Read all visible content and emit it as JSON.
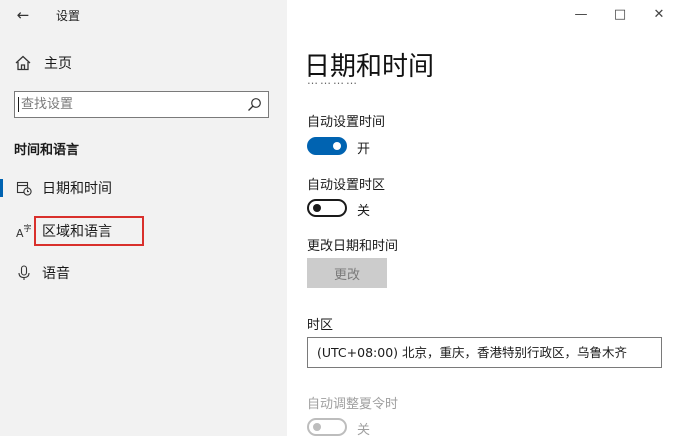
{
  "window": {
    "title": "设置",
    "controls": [
      "minimize-icon",
      "maximize-icon",
      "close-icon"
    ]
  },
  "sidebar": {
    "home_label": "主页",
    "search": {
      "placeholder": "查找设置",
      "value": ""
    },
    "section_title": "时间和语言",
    "items": [
      {
        "label": "日期和时间",
        "icon": "calendar-clock-icon",
        "active": true
      },
      {
        "label": "区域和语言",
        "icon": "language-icon",
        "highlighted": true
      },
      {
        "label": "语音",
        "icon": "microphone-icon"
      }
    ]
  },
  "main": {
    "title": "日期和时间",
    "clipped_text": "…………",
    "auto_time": {
      "label": "自动设置时间",
      "state": "开"
    },
    "auto_timezone": {
      "label": "自动设置时区",
      "state": "关"
    },
    "change_datetime": {
      "label": "更改日期和时间",
      "button": "更改"
    },
    "timezone": {
      "label": "时区",
      "value": "(UTC+08:00) 北京，重庆，香港特别行政区，乌鲁木齐"
    },
    "dst": {
      "label": "自动调整夏令时",
      "state": "关"
    }
  },
  "colors": {
    "accent": "#0063b1",
    "sidebar_bg": "#f2f2f2",
    "highlight_border": "#d9302c"
  }
}
